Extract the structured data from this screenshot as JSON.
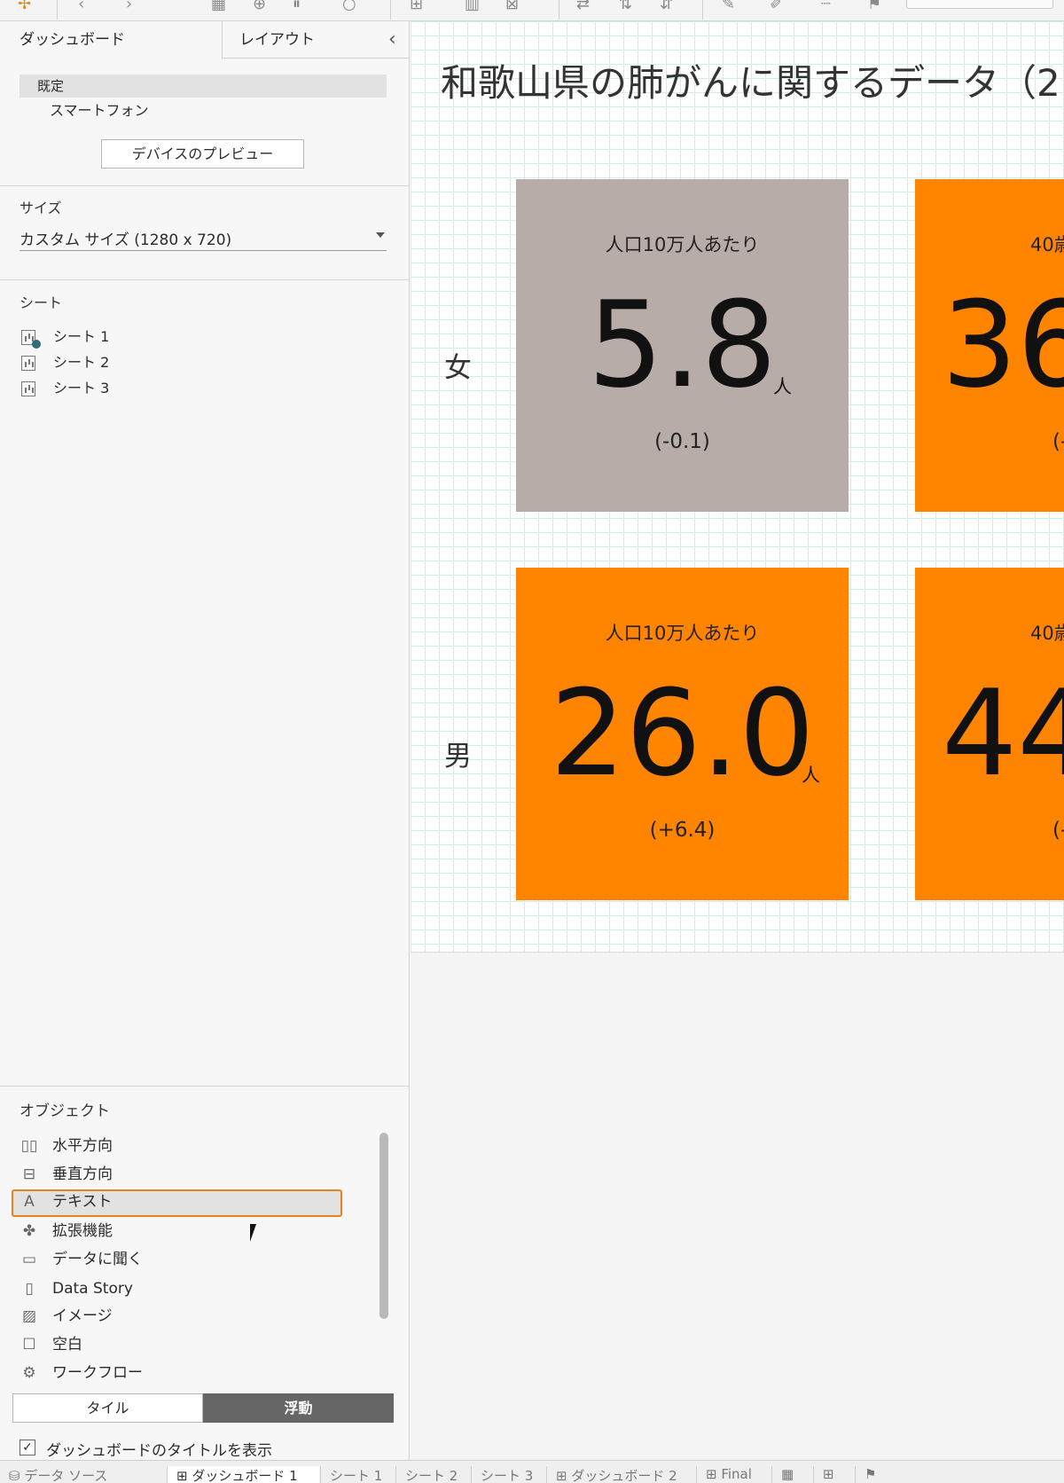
{
  "panel": {
    "tabs": {
      "dashboard": "ダッシュボード",
      "layout": "レイアウト"
    },
    "devices": {
      "default": "既定",
      "phone": "スマートフォン",
      "preview_button": "デバイスのプレビュー"
    },
    "size": {
      "label": "サイズ",
      "value": "カスタム サイズ (1280 x 720)"
    },
    "sheets": {
      "label": "シート",
      "items": [
        "シート 1",
        "シート 2",
        "シート 3"
      ]
    },
    "objects": {
      "label": "オブジェクト",
      "items": [
        "水平方向",
        "垂直方向",
        "テキスト",
        "拡張機能",
        "データに聞く",
        "Data Story",
        "イメージ",
        "空白",
        "ワークフロー"
      ],
      "selected": "テキスト"
    },
    "mode": {
      "tile": "タイル",
      "float": "浮動",
      "active": "浮動"
    },
    "show_title": {
      "label": "ダッシュボードのタイトルを表示",
      "checked": true
    }
  },
  "dashboard": {
    "title": "和歌山県の肺がんに関するデータ（2",
    "rows": [
      {
        "label": "女",
        "cards": [
          {
            "caption": "人口10万人あたり",
            "value": "5.8",
            "unit": "人",
            "delta": "(-0.1)",
            "color": "#b8aca8"
          },
          {
            "caption": "40歳",
            "value": "36",
            "unit": "",
            "delta": "(-",
            "color": "#ff8500"
          }
        ]
      },
      {
        "label": "男",
        "cards": [
          {
            "caption": "人口10万人あたり",
            "value": "26.0",
            "unit": "人",
            "delta": "(+6.4)",
            "color": "#ff8500"
          },
          {
            "caption": "40歳",
            "value": "44",
            "unit": "",
            "delta": "(-",
            "color": "#ff8500"
          }
        ]
      }
    ]
  },
  "bottom_tabs": [
    "データ ソース",
    "ダッシュボード 1",
    "シート 1",
    "シート 2",
    "シート 3",
    "ダッシュボード 2",
    "Final"
  ],
  "colors": {
    "accent_orange": "#ff8500",
    "grey_card": "#b8aca8",
    "selection_border": "#e8811e",
    "grid": "#cfeef2"
  }
}
